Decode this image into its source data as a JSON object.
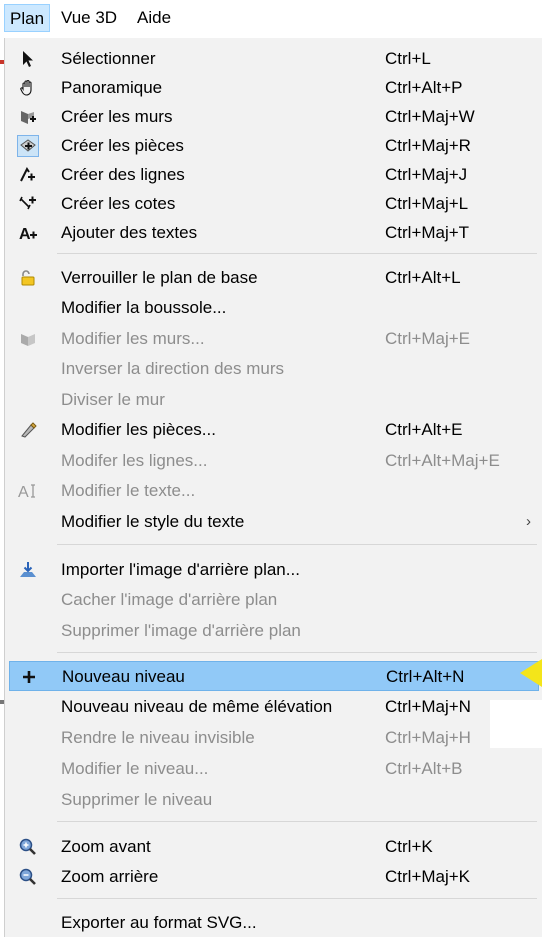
{
  "menubar": {
    "items": [
      {
        "label": "Plan"
      },
      {
        "label": "Vue 3D"
      },
      {
        "label": "Aide"
      }
    ]
  },
  "menu": {
    "items": [
      {
        "label": "Sélectionner",
        "shortcut": "Ctrl+L",
        "icon": "arrow-pointer-icon"
      },
      {
        "label": "Panoramique",
        "shortcut": "Ctrl+Alt+P",
        "icon": "hand-pan-icon"
      },
      {
        "label": "Créer les murs",
        "shortcut": "Ctrl+Maj+W",
        "icon": "create-walls-icon"
      },
      {
        "label": "Créer les pièces",
        "shortcut": "Ctrl+Maj+R",
        "icon": "create-rooms-icon"
      },
      {
        "label": "Créer des lignes",
        "shortcut": "Ctrl+Maj+J",
        "icon": "create-lines-icon"
      },
      {
        "label": "Créer les cotes",
        "shortcut": "Ctrl+Maj+L",
        "icon": "create-dimensions-icon"
      },
      {
        "label": "Ajouter des textes",
        "shortcut": "Ctrl+Maj+T",
        "icon": "add-text-icon"
      },
      {
        "label": "Verrouiller le plan de base",
        "shortcut": "Ctrl+Alt+L",
        "icon": "lock-icon"
      },
      {
        "label": "Modifier la boussole...",
        "shortcut": ""
      },
      {
        "label": "Modifier les murs...",
        "shortcut": "Ctrl+Maj+E",
        "icon": "modify-walls-icon"
      },
      {
        "label": "Inverser la direction des murs",
        "shortcut": ""
      },
      {
        "label": "Diviser le mur",
        "shortcut": ""
      },
      {
        "label": "Modifier les pièces...",
        "shortcut": "Ctrl+Alt+E",
        "icon": "modify-rooms-icon"
      },
      {
        "label": "Modifer les lignes...",
        "shortcut": "Ctrl+Alt+Maj+E"
      },
      {
        "label": "Modifier le texte...",
        "shortcut": "",
        "icon": "modify-text-icon"
      },
      {
        "label": "Modifier le style du texte",
        "shortcut": "",
        "submenu_arrow": "›"
      },
      {
        "label": "Importer l'image d'arrière plan...",
        "shortcut": "",
        "icon": "import-image-icon"
      },
      {
        "label": "Cacher l'image d'arrière plan",
        "shortcut": ""
      },
      {
        "label": "Supprimer l'image d'arrière plan",
        "shortcut": ""
      },
      {
        "label": "Nouveau niveau",
        "shortcut": "Ctrl+Alt+N",
        "icon": "plus-icon"
      },
      {
        "label": "Nouveau niveau de même élévation",
        "shortcut": "Ctrl+Maj+N"
      },
      {
        "label": "Rendre le niveau invisible",
        "shortcut": "Ctrl+Maj+H"
      },
      {
        "label": "Modifier le niveau...",
        "shortcut": "Ctrl+Alt+B"
      },
      {
        "label": "Supprimer le niveau",
        "shortcut": ""
      },
      {
        "label": "Zoom avant",
        "shortcut": "Ctrl+K",
        "icon": "zoom-in-icon"
      },
      {
        "label": "Zoom arrière",
        "shortcut": "Ctrl+Maj+K",
        "icon": "zoom-out-icon"
      },
      {
        "label": "Exporter au format SVG...",
        "shortcut": ""
      }
    ]
  },
  "colors": {
    "highlight": "#91c9f7",
    "menubar_active": "#cce8ff",
    "disabled_text": "#8d8d8d",
    "pointer": "#f4e51a"
  }
}
